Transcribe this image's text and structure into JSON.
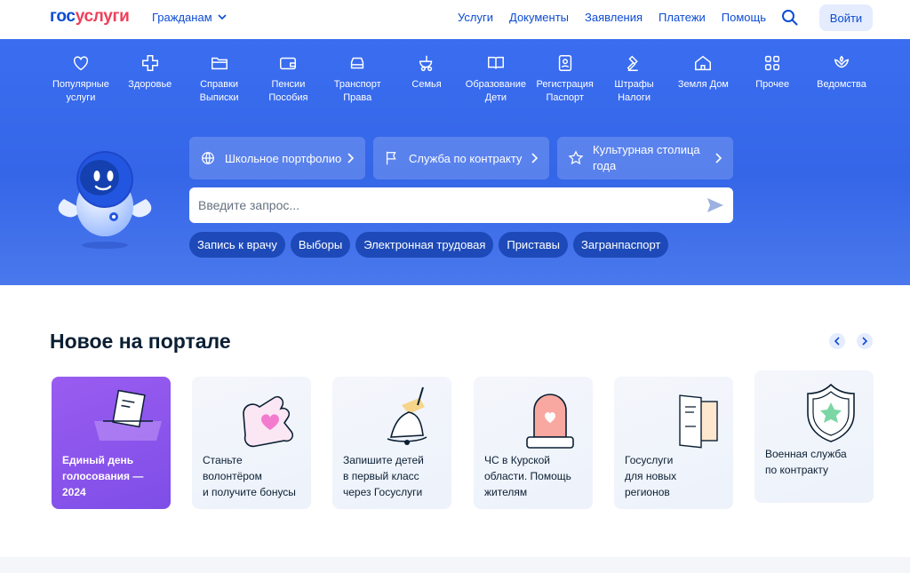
{
  "header": {
    "logo_part1": "гос",
    "logo_part2": "услуги",
    "role_label": "Гражданам",
    "nav": [
      "Услуги",
      "Документы",
      "Заявления",
      "Платежи",
      "Помощь"
    ],
    "login_label": "Войти",
    "icons": {
      "search": "search-icon",
      "role": "chevron-down-icon"
    }
  },
  "categories": [
    {
      "l1": "Популярные",
      "l2": "услуги",
      "icon": "heart-icon"
    },
    {
      "l1": "Здоровье",
      "l2": "",
      "icon": "medical-cross-icon"
    },
    {
      "l1": "Справки",
      "l2": "Выписки",
      "icon": "folder-icon"
    },
    {
      "l1": "Пенсии",
      "l2": "Пособия",
      "icon": "wallet-icon"
    },
    {
      "l1": "Транспорт",
      "l2": "Права",
      "icon": "car-icon"
    },
    {
      "l1": "Семья",
      "l2": "",
      "icon": "stroller-icon"
    },
    {
      "l1": "Образование",
      "l2": "Дети",
      "icon": "book-icon"
    },
    {
      "l1": "Регистрация",
      "l2": "Паспорт",
      "icon": "id-card-icon"
    },
    {
      "l1": "Штрафы",
      "l2": "Налоги",
      "icon": "gavel-icon"
    },
    {
      "l1": "Земля Дом",
      "l2": "",
      "icon": "house-icon"
    },
    {
      "l1": "Прочее",
      "l2": "",
      "icon": "grid-icon"
    },
    {
      "l1": "Ведомства",
      "l2": "",
      "icon": "emblem-icon"
    }
  ],
  "quick_cards": [
    {
      "label": "Школьное портфолио",
      "icon": "globe-icon"
    },
    {
      "label": "Служба по контракту",
      "icon": "flag-icon"
    },
    {
      "label_l1": "Культурная столица",
      "label_l2": "года",
      "icon": "star-icon"
    }
  ],
  "search": {
    "placeholder": "Введите запрос...",
    "icon": "send-icon"
  },
  "chips": [
    "Запись к врачу",
    "Выборы",
    "Электронная трудовая",
    "Приставы",
    "Загранпаспорт"
  ],
  "news": {
    "title": "Новое на портале",
    "cards": [
      {
        "l1": "Единый день",
        "l2": "голосования —",
        "l3": "2024",
        "icon": "ballot-box-icon"
      },
      {
        "l1": "Станьте",
        "l2": "волонтёром",
        "l3": "и получите бонусы",
        "icon": "puzzle-heart-icon"
      },
      {
        "l1": "Запишите детей",
        "l2": "в первый класс",
        "l3": "через Госуслуги",
        "icon": "school-bell-icon"
      },
      {
        "l1": "ЧС в Курской",
        "l2": "области. Помощь",
        "l3": "жителям",
        "icon": "alarm-light-icon"
      },
      {
        "l1": "Госуслуги",
        "l2": "для новых",
        "l3": "регионов",
        "icon": "documents-icon"
      },
      {
        "l1": "Военная служба",
        "l2": "по контракту",
        "l3": "",
        "icon": "shield-star-icon"
      }
    ]
  }
}
